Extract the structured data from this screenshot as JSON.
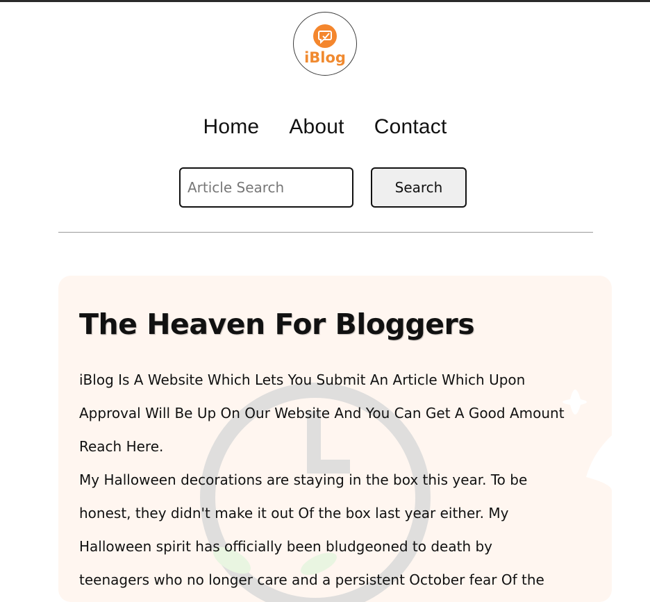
{
  "logo": {
    "text": "iBlog"
  },
  "nav": {
    "items": [
      {
        "label": "Home"
      },
      {
        "label": "About"
      },
      {
        "label": "Contact"
      }
    ]
  },
  "search": {
    "placeholder": "Article Search",
    "value": "",
    "button_label": "Search"
  },
  "hero": {
    "title": "The Heaven For Bloggers",
    "paragraphs": [
      "iBlog Is A Website Which Lets You Submit An Article Which Upon Approval Will Be Up On Our Website And You Can Get A Good Amount Reach Here.",
      "My Halloween decorations are staying in the box this year. To be honest, they didn't make it out Of the box last year either. My Halloween spirit has officially been bludgeoned to death by teenagers who no longer care and a persistent October fear Of the"
    ]
  },
  "colors": {
    "brand": "#f4862d",
    "hero_background": "#fff6f0",
    "button_background": "#efefef"
  }
}
